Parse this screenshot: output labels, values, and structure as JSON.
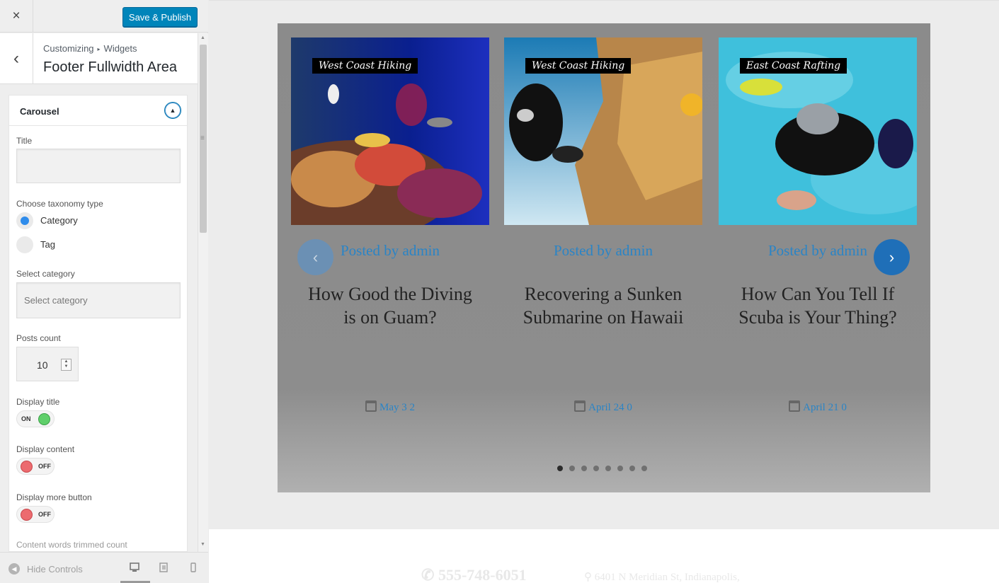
{
  "customizer": {
    "close_label": "×",
    "save_label": "Save & Publish",
    "breadcrumb": {
      "root": "Customizing",
      "sep": "▸",
      "leaf": "Widgets"
    },
    "section_title": "Footer Fullwidth Area",
    "back_label": "‹",
    "widget": {
      "title": "Carousel",
      "title_field": {
        "label": "Title",
        "value": ""
      },
      "taxonomy": {
        "label": "Choose taxonomy type",
        "options": [
          {
            "label": "Category",
            "selected": true
          },
          {
            "label": "Tag",
            "selected": false
          }
        ]
      },
      "category": {
        "label": "Select category",
        "placeholder": "Select category"
      },
      "posts_count": {
        "label": "Posts count",
        "value": "10"
      },
      "display_title": {
        "label": "Display title",
        "state": "ON"
      },
      "display_content": {
        "label": "Display content",
        "state": "OFF"
      },
      "display_more": {
        "label": "Display more button",
        "state": "OFF"
      },
      "trim_label": "Content words trimmed count"
    },
    "footer": {
      "hide_controls": "Hide Controls"
    }
  },
  "preview": {
    "slides": [
      {
        "category": "West Coast Hiking",
        "posted": "Posted by admin",
        "title": "How Good the Diving is on Guam?",
        "date": "May 3 2"
      },
      {
        "category": "West Coast Hiking",
        "posted": "Posted by admin",
        "title": "Recovering a Sunken Submarine on Hawaii",
        "date": "April 24 0"
      },
      {
        "category": "East Coast Rafting",
        "posted": "Posted by admin",
        "title": "How Can You Tell If Scuba is Your Thing?",
        "date": "April 21 0"
      }
    ],
    "nav_prev": "‹",
    "nav_next": "›",
    "dots_count": 8,
    "active_dot": 1,
    "footer": {
      "phone": "555-748-6051",
      "address": "6401 N Meridian St, Indianapolis,"
    }
  },
  "colors": {
    "accent": "#0085ba",
    "link": "#2a84c6",
    "toggle_on": "#5fcf6a",
    "toggle_off": "#ec6b6f"
  },
  "icons": [
    "close-icon",
    "chevron-left-icon",
    "collapse-arrow-icon",
    "radio-icon",
    "stepper-icon",
    "desktop-icon",
    "tablet-icon",
    "mobile-icon",
    "calendar-icon",
    "phone-icon",
    "location-icon"
  ]
}
